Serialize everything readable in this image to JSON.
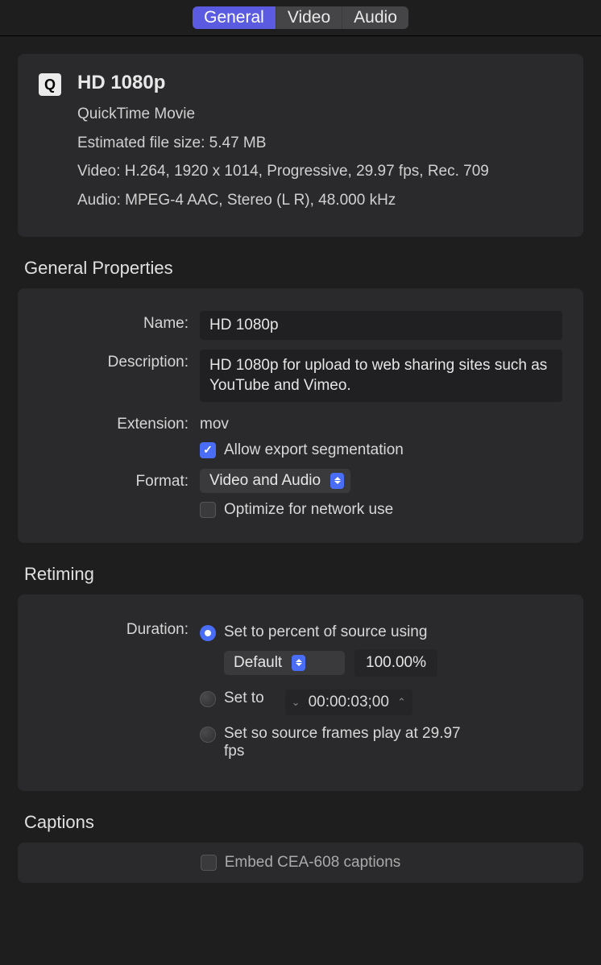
{
  "tabs": {
    "general": "General",
    "video": "Video",
    "audio": "Audio"
  },
  "summary": {
    "title": "HD 1080p",
    "container": "QuickTime Movie",
    "filesize": "Estimated file size: 5.47 MB",
    "video": "Video: H.264, 1920 x 1014, Progressive, 29.97 fps, Rec. 709",
    "audio": "Audio: MPEG-4 AAC, Stereo (L R), 48.000 kHz"
  },
  "sections": {
    "general": "General Properties",
    "retiming": "Retiming",
    "captions": "Captions"
  },
  "general": {
    "labels": {
      "name": "Name:",
      "description": "Description:",
      "extension": "Extension:",
      "format": "Format:"
    },
    "name": "HD 1080p",
    "description": "HD 1080p for upload to web sharing sites such as YouTube and Vimeo.",
    "extension": "mov",
    "allow_segmentation": "Allow export segmentation",
    "format": "Video and Audio",
    "optimize_network": "Optimize for network use"
  },
  "retiming": {
    "labels": {
      "duration": "Duration:"
    },
    "opt_percent": "Set to percent of source using",
    "percent_select": "Default",
    "percent_value": "100.00%",
    "opt_setto": "Set to",
    "setto_value": "00:00:03;00",
    "opt_frames": "Set so source frames play at 29.97 fps"
  },
  "captions": {
    "embed": "Embed CEA-608 captions"
  }
}
